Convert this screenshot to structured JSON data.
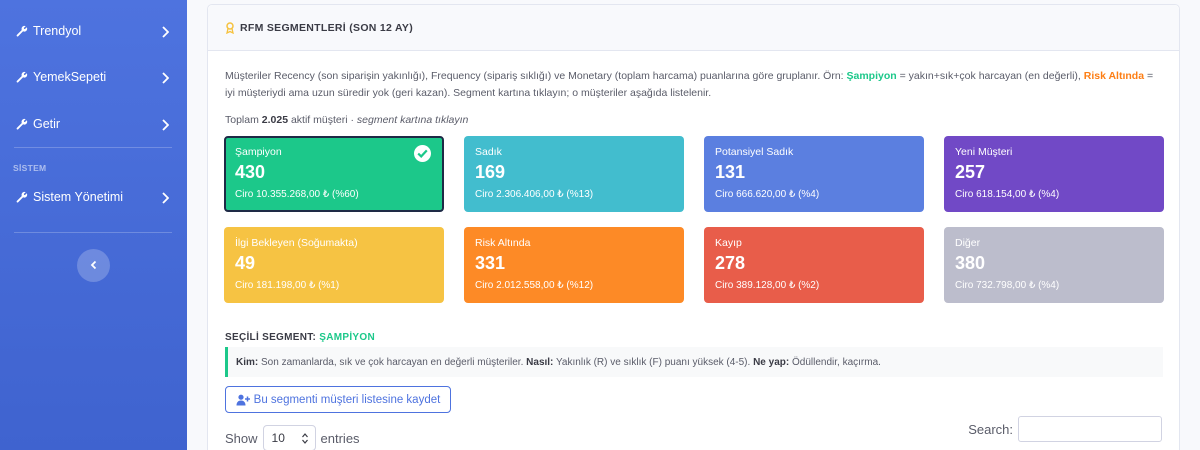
{
  "sidebar": {
    "items": [
      {
        "label": "Trendyol",
        "icon": "wrench-icon"
      },
      {
        "label": "YemekSepeti",
        "icon": "wrench-icon"
      },
      {
        "label": "Getir",
        "icon": "wrench-icon"
      }
    ],
    "heading": "SİSTEM",
    "system_item": {
      "label": "Sistem Yönetimi",
      "icon": "wrench-icon"
    },
    "toggle_icon": "chevron-left-icon"
  },
  "card": {
    "title": "RFM SEGMENTLERİ (SON 12 AY)",
    "title_icon": "award-icon",
    "desc_part1": "Müşteriler Recency (son siparişin yakınlığı), Frequency (sipariş sıklığı) ve Monetary (toplam harcama) puanlarına göre gruplanır. Örn: ",
    "desc_champ": "Şampiyon",
    "desc_part2": " = yakın+sık+çok harcayan (en değerli), ",
    "desc_risk": "Risk Altında",
    "desc_part3": " = iyi müşteriydi ama uzun süredir yok (geri kazan). Segment kartına tıklayın; o müşteriler aşağıda listelenir.",
    "total_prefix": "Toplam ",
    "total_count": "2.025",
    "total_suffix": " aktif müşteri · ",
    "total_hint": "segment kartına tıklayın"
  },
  "segments": [
    {
      "name": "Şampiyon",
      "count": "430",
      "ciro": "Ciro 10.355.268,00 ₺ (%60)",
      "color": "#1cc88a",
      "active": true
    },
    {
      "name": "Sadık",
      "count": "169",
      "ciro": "Ciro 2.306.406,00 ₺ (%13)",
      "color": "#42bdce"
    },
    {
      "name": "Potansiyel Sadık",
      "count": "131",
      "ciro": "Ciro 666.620,00 ₺ (%4)",
      "color": "#5b7fe0"
    },
    {
      "name": "Yeni Müşteri",
      "count": "257",
      "ciro": "Ciro 618.154,00 ₺ (%4)",
      "color": "#7149c6"
    },
    {
      "name": "İlgi Bekleyen (Soğumakta)",
      "count": "49",
      "ciro": "Ciro 181.198,00 ₺ (%1)",
      "color": "#f6c343"
    },
    {
      "name": "Risk Altında",
      "count": "331",
      "ciro": "Ciro 2.012.558,00 ₺ (%12)",
      "color": "#fd8a26"
    },
    {
      "name": "Kayıp",
      "count": "278",
      "ciro": "Ciro 389.128,00 ₺ (%2)",
      "color": "#e85d4a"
    },
    {
      "name": "Diğer",
      "count": "380",
      "ciro": "Ciro 732.798,00 ₺ (%4)",
      "color": "#bcbdcc"
    }
  ],
  "selected": {
    "label": "SEÇİLİ SEGMENT: ",
    "name": "ŞAMPİYON",
    "kim_label": "Kim:",
    "kim_text": " Son zamanlarda, sık ve çok harcayan en değerli müşteriler. ",
    "nasil_label": "Nasıl:",
    "nasil_text": " Yakınlık (R) ve sıklık (F) puanı yüksek (4-5). ",
    "neyap_label": "Ne yap:",
    "neyap_text": " Ödüllendir, kaçırma."
  },
  "save_button": {
    "label": "Bu segmenti müşteri listesine kaydet",
    "icon": "user-plus-icon"
  },
  "table_controls": {
    "show_label": "Show",
    "length_value": "10",
    "entries_label": "entries",
    "search_label": "Search:",
    "search_value": ""
  }
}
